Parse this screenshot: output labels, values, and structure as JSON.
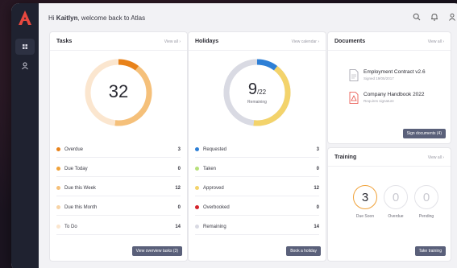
{
  "colors": {
    "brand": "#e8483f",
    "accent": "#e8821a",
    "button": "#5a607a"
  },
  "header": {
    "greeting_prefix": "Hi",
    "user_name": "Kaitlyn",
    "greeting_suffix": ", welcome back to Atlas"
  },
  "rail": {
    "items": [
      {
        "icon": "grid-icon"
      },
      {
        "icon": "user-icon"
      }
    ]
  },
  "tasks": {
    "title": "Tasks",
    "link": "View all",
    "total": "32",
    "rows": [
      {
        "label": "Overdue",
        "value": "3",
        "color": "#e8821a"
      },
      {
        "label": "Due Today",
        "value": "0",
        "color": "#f0a23a"
      },
      {
        "label": "Due this Week",
        "value": "12",
        "color": "#f5c07a"
      },
      {
        "label": "Due this Month",
        "value": "0",
        "color": "#f7d3a6"
      },
      {
        "label": "To Do",
        "value": "14",
        "color": "#fbe6cf"
      }
    ],
    "button": "View overview tasks (3)"
  },
  "holidays": {
    "title": "Holidays",
    "link": "View calendar",
    "used": "9",
    "total": "/22",
    "caption": "Remaining",
    "rows": [
      {
        "label": "Requested",
        "value": "3",
        "color": "#2d7fd6"
      },
      {
        "label": "Taken",
        "value": "0",
        "color": "#b7e07a"
      },
      {
        "label": "Approved",
        "value": "12",
        "color": "#f3d36b"
      },
      {
        "label": "Overbooked",
        "value": "0",
        "color": "#d4232b"
      },
      {
        "label": "Remaining",
        "value": "14",
        "color": "#d9dae3"
      }
    ],
    "button": "Book a holiday"
  },
  "documents": {
    "title": "Documents",
    "link": "View all",
    "items": [
      {
        "name": "Employment Contract v2.6",
        "status": "Signed 19/05/2017",
        "icon": "document-icon"
      },
      {
        "name": "Company Handbook 2022",
        "status": "Requires signature",
        "icon": "warning-document-icon"
      }
    ],
    "button": "Sign documents (4)"
  },
  "training": {
    "title": "Training",
    "link": "View all",
    "items": [
      {
        "value": "3",
        "label": "Due Soon"
      },
      {
        "value": "0",
        "label": "Overdue"
      },
      {
        "value": "0",
        "label": "Pending"
      }
    ],
    "button": "Take training"
  },
  "chart_data": [
    {
      "type": "pie",
      "categories": [
        "Overdue",
        "Due Today",
        "Due this Week",
        "Due this Month",
        "To Do"
      ],
      "values": [
        3,
        0,
        12,
        0,
        14
      ]
    },
    {
      "type": "pie",
      "categories": [
        "Requested",
        "Taken",
        "Approved",
        "Overbooked",
        "Remaining"
      ],
      "values": [
        3,
        0,
        12,
        0,
        14
      ]
    }
  ]
}
